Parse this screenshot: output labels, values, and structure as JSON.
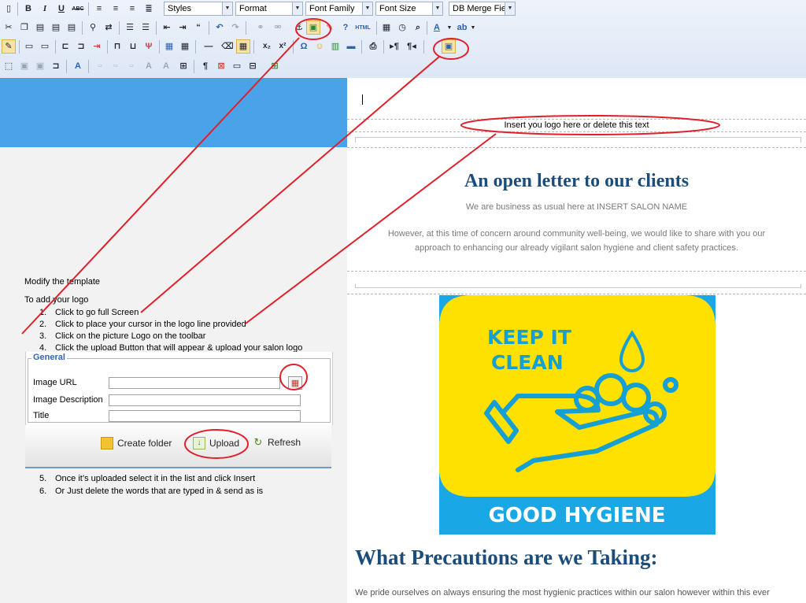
{
  "toolbar": {
    "row1": {
      "styles_label": "Styles",
      "format_label": "Format",
      "font_family_label": "Font Family",
      "font_size_label": "Font Size",
      "merge_label": "DB Merge Fielc"
    },
    "bold": "B",
    "italic": "I",
    "underline": "U",
    "strike": "ABC",
    "html": "HTML",
    "omega": "Ω",
    "para": "¶",
    "text_color": "A",
    "subscript": "x₂",
    "superscript": "x²"
  },
  "editor": {
    "logo_placeholder": "Insert you logo here or delete this text",
    "letter_title": "An open letter to our clients",
    "letter_subtitle": "We are business as usual here at INSERT SALON NAME",
    "letter_body_1": "However, at this time of concern around community well-being, we would like to share with you our",
    "letter_body_2": "approach to enhancing our already vigilant salon hygiene and client safety practices.",
    "poster": {
      "line1": "KEEP IT",
      "line2": "CLEAN",
      "footer": "GOOD HYGIENE",
      "yellow": "#ffe100",
      "blue": "#1aa7e6",
      "teal": "#169fd3"
    },
    "precautions_title": "What Precautions are we Taking:",
    "precautions_body": "We pride ourselves on always ensuring the most hygienic practices within our salon however within this ever"
  },
  "instructions": {
    "heading": "Modify the template",
    "subheading": "To add your logo",
    "steps": [
      {
        "num": "1.",
        "text": "Click to go full Screen"
      },
      {
        "num": "2.",
        "text": "Click to place your cursor in the logo line provided"
      },
      {
        "num": "3.",
        "text": "Click on the picture Logo on the toolbar"
      },
      {
        "num": "4.",
        "text": "Click the upload Button that will appear & upload your salon logo"
      },
      {
        "num": "5.",
        "text": "Once it’s uploaded select it in the list and click Insert"
      },
      {
        "num": "6.",
        "text": "Or Just delete the words that are typed in & send as is"
      }
    ]
  },
  "dialog": {
    "legend": "General",
    "image_url_label": "Image URL",
    "image_desc_label": "Image Description",
    "title_label": "Title",
    "create_folder": "Create folder",
    "upload": "Upload",
    "refresh": "Refresh"
  },
  "colors": {
    "header_blue": "#4aa3e8",
    "title_navy": "#1c4d7a",
    "annotation_red": "#e0202a"
  }
}
